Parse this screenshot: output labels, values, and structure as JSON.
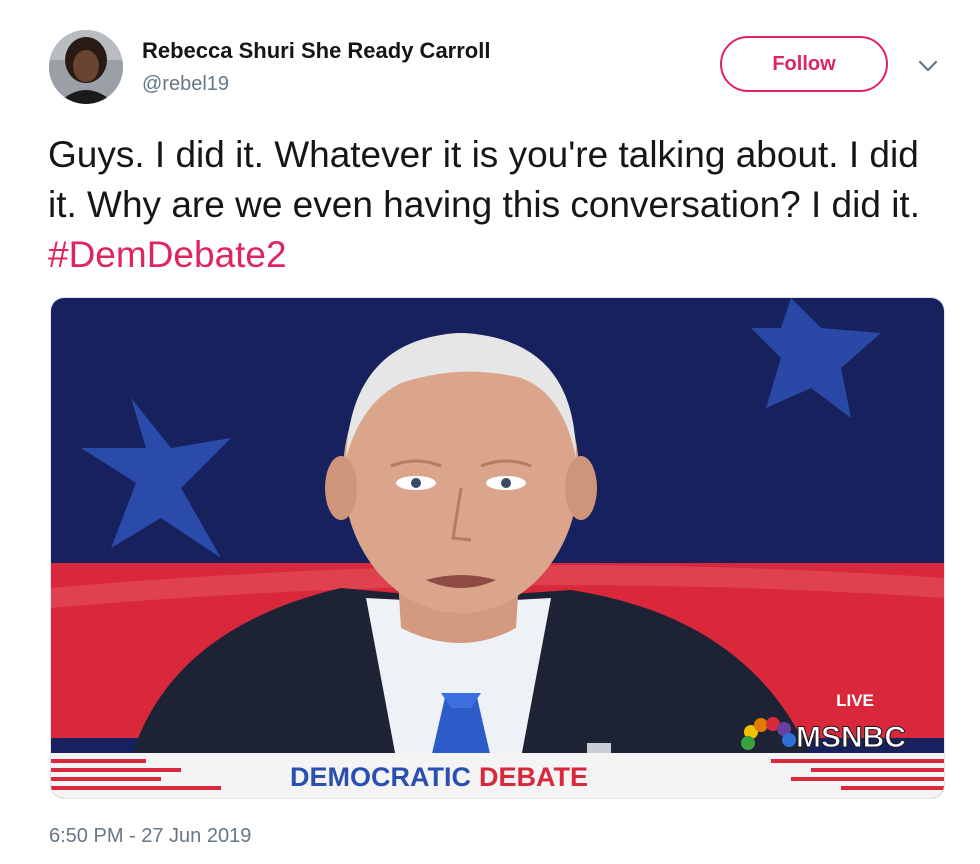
{
  "tweet": {
    "author": {
      "display_name": "Rebecca Shuri She Ready Carroll",
      "handle": "@rebel19"
    },
    "follow_label": "Follow",
    "text_main": "Guys. I did it. Whatever it is you're talking about. I did it. Why are we even having this conversation? I did it. ",
    "hashtag": "#DemDebate2",
    "timestamp": "6:50 PM - 27 Jun 2019"
  },
  "media": {
    "live_label": "LIVE",
    "network_label": "MSNBC",
    "banner_left": "DEMOCRATIC",
    "banner_right": "DEBATE"
  },
  "colors": {
    "accent": "#e0245e",
    "text": "#14171a",
    "secondary_text": "#657786",
    "stage_blue": "#16215e",
    "stage_red": "#d9283b"
  },
  "icons": {
    "caret": "chevron-down-icon"
  }
}
